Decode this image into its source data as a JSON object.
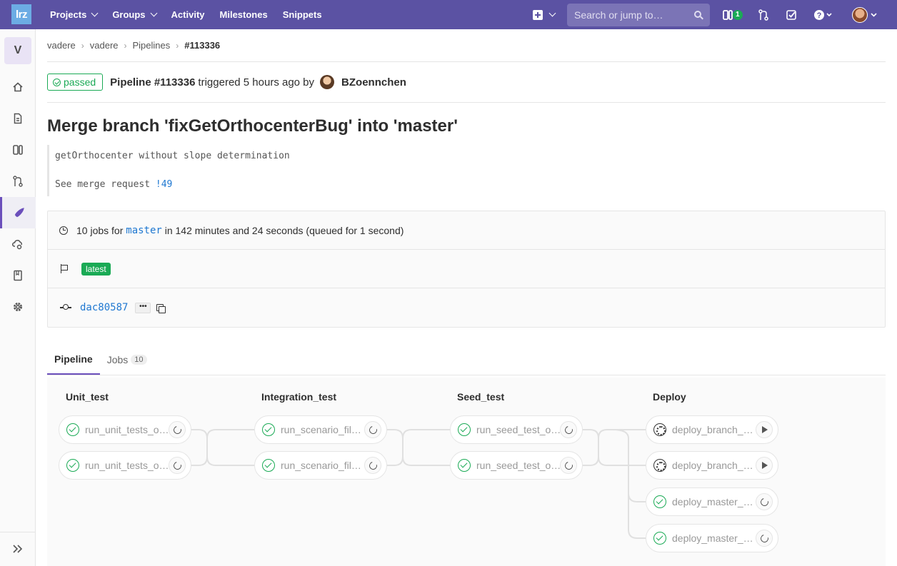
{
  "nav": {
    "logo": "lrz",
    "links": [
      "Projects",
      "Groups",
      "Activity",
      "Milestones",
      "Snippets"
    ],
    "search_placeholder": "Search or jump to…",
    "issues_count": "1",
    "colors": {
      "bar": "#5b52a3",
      "accent": "#6b4fbb"
    }
  },
  "sidebar": {
    "project_letter": "V",
    "items": [
      "home-icon",
      "document-icon",
      "issues-icon",
      "merge-request-icon",
      "rocket-icon",
      "operations-icon",
      "wiki-icon",
      "settings-icon"
    ],
    "active": "rocket-icon"
  },
  "breadcrumb": [
    "vadere",
    "vadere",
    "Pipelines",
    "#113336"
  ],
  "header": {
    "status": "passed",
    "pipeline": "Pipeline #113336",
    "triggered": "triggered 5 hours ago by",
    "user": "BZoennchen"
  },
  "commit": {
    "title": "Merge branch 'fixGetOrthocenterBug' into 'master'",
    "desc_line1": "getOrthocenter without slope determination",
    "desc_line2_prefix": "See merge request ",
    "desc_link": "!49"
  },
  "info": {
    "jobs_prefix": "10 jobs for ",
    "branch": "master",
    "jobs_suffix": " in 142 minutes and 24 seconds (queued for 1 second)",
    "badge": "latest",
    "sha": "dac80587",
    "ellipsis": "•••"
  },
  "tabs": [
    {
      "label": "Pipeline",
      "active": true
    },
    {
      "label": "Jobs",
      "count": "10"
    }
  ],
  "stages": [
    {
      "name": "Unit_test",
      "jobs": [
        {
          "name": "run_unit_tests_o…",
          "status": "success",
          "action": "retry"
        },
        {
          "name": "run_unit_tests_o…",
          "status": "success",
          "action": "retry"
        }
      ]
    },
    {
      "name": "Integration_test",
      "jobs": [
        {
          "name": "run_scenario_fil…",
          "status": "success",
          "action": "retry"
        },
        {
          "name": "run_scenario_fil…",
          "status": "success",
          "action": "retry"
        }
      ]
    },
    {
      "name": "Seed_test",
      "jobs": [
        {
          "name": "run_seed_test_o…",
          "status": "success",
          "action": "retry"
        },
        {
          "name": "run_seed_test_o…",
          "status": "success",
          "action": "retry"
        }
      ]
    },
    {
      "name": "Deploy",
      "jobs": [
        {
          "name": "deploy_branch_…",
          "status": "manual",
          "action": "play"
        },
        {
          "name": "deploy_branch_…",
          "status": "manual",
          "action": "play"
        },
        {
          "name": "deploy_master_…",
          "status": "success",
          "action": "retry"
        },
        {
          "name": "deploy_master_…",
          "status": "success",
          "action": "retry"
        }
      ]
    }
  ]
}
